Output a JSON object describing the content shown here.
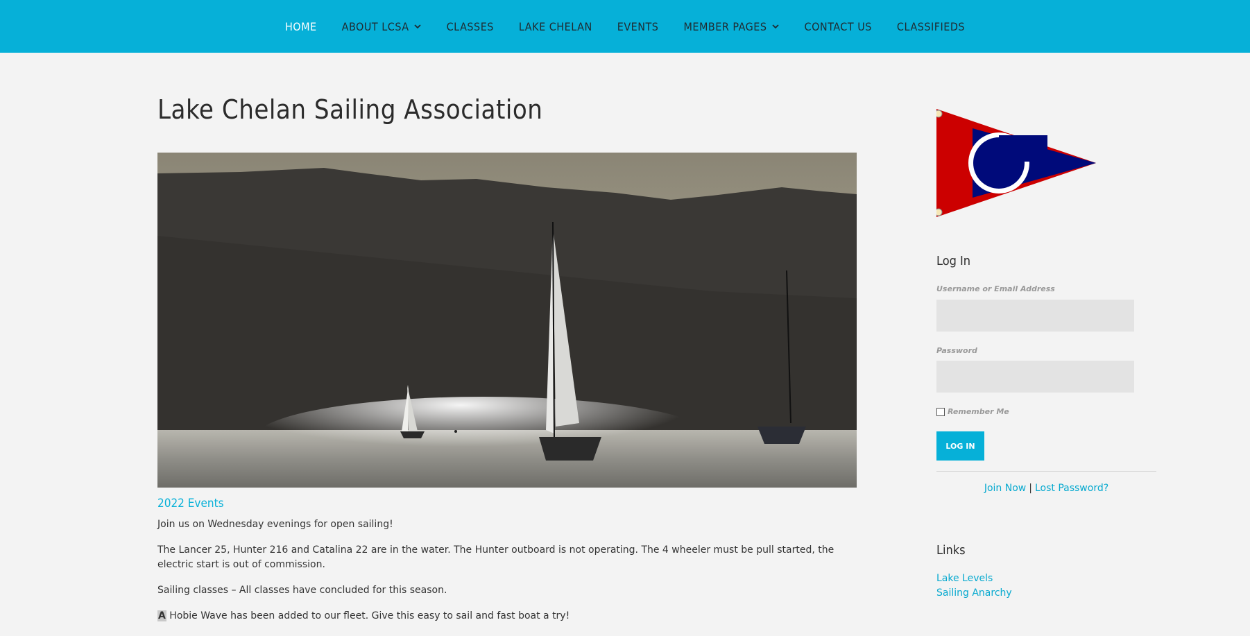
{
  "colors": {
    "accent": "#06b0d8",
    "background": "#f3f3f3",
    "text": "#333333"
  },
  "nav": {
    "items": [
      {
        "label": "HOME",
        "active": true,
        "dropdown": false
      },
      {
        "label": "ABOUT LCSA",
        "active": false,
        "dropdown": true
      },
      {
        "label": "CLASSES",
        "active": false,
        "dropdown": false
      },
      {
        "label": "LAKE CHELAN",
        "active": false,
        "dropdown": false
      },
      {
        "label": "EVENTS",
        "active": false,
        "dropdown": false
      },
      {
        "label": "MEMBER PAGES",
        "active": false,
        "dropdown": true
      },
      {
        "label": "CONTACT US",
        "active": false,
        "dropdown": false
      },
      {
        "label": "CLASSIFIEDS",
        "active": false,
        "dropdown": false
      }
    ]
  },
  "main": {
    "title": "Lake Chelan Sailing Association",
    "events_heading": "2022 Events",
    "paragraphs": [
      "Join us on Wednesday evenings for open sailing!",
      "The Lancer 25, Hunter 216 and Catalina 22 are in the water. The Hunter outboard is not operating. The 4 wheeler must be pull started, the electric start is out of commission.",
      "Sailing classes – All classes have concluded for this season."
    ],
    "last_para_first": "A",
    "last_para_rest": " Hobie Wave has been added to our fleet. Give this easy to sail and fast boat a try!"
  },
  "sidebar": {
    "login": {
      "title": "Log In",
      "username_label": "Username or Email Address",
      "password_label": "Password",
      "remember_label": "Remember Me",
      "button_label": "LOG IN",
      "join_label": "Join Now",
      "separator": "|",
      "lost_password_label": "Lost Password?"
    },
    "links": {
      "title": "Links",
      "items": [
        "Lake Levels",
        "Sailing Anarchy"
      ]
    }
  },
  "icons": {
    "burgee": "club-burgee-icon",
    "chevron": "chevron-down-icon"
  }
}
